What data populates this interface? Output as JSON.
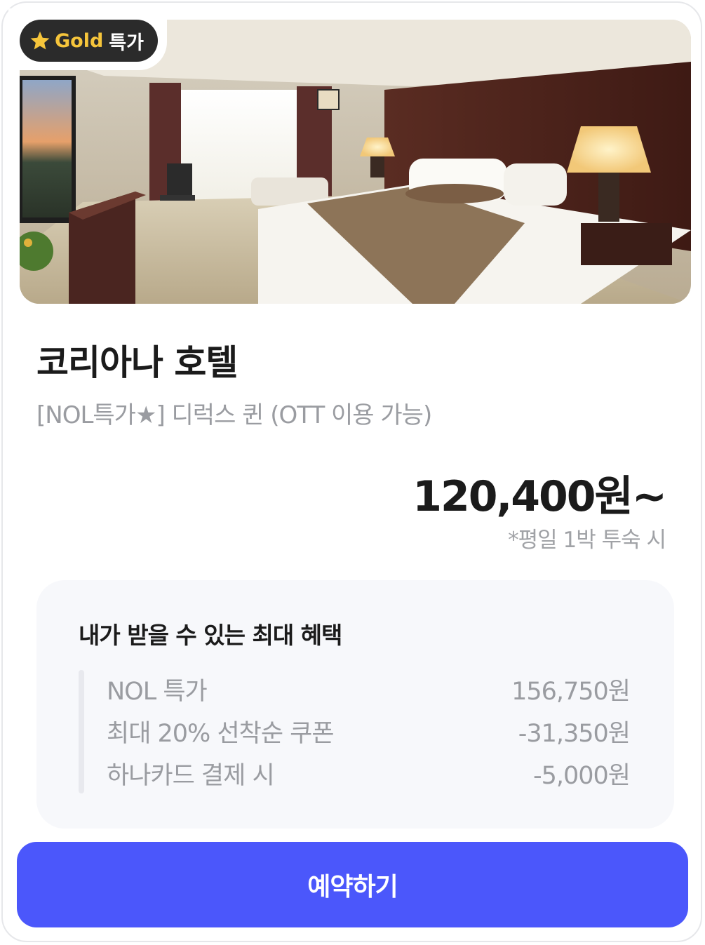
{
  "badge": {
    "icon": "star-icon",
    "tier": "Gold",
    "label": "특가"
  },
  "hotel": {
    "name": "코리아나 호텔",
    "room": "[NOL특가★] 디럭스 퀸 (OTT 이용 가능)",
    "price": "120,400원~",
    "price_note": "*평일 1박 투숙 시"
  },
  "benefits": {
    "title": "내가 받을 수 있는 최대 혜택",
    "rows": [
      {
        "label": "NOL 특가",
        "amount": "156,750원"
      },
      {
        "label": "최대 20% 선착순 쿠폰",
        "amount": "-31,350원"
      },
      {
        "label": "하나카드 결제 시",
        "amount": "-5,000원"
      }
    ]
  },
  "cta": {
    "label": "예약하기"
  },
  "colors": {
    "accent": "#4b57fb",
    "gold": "#f6c53b",
    "badge_bg": "#2b2b2b"
  }
}
